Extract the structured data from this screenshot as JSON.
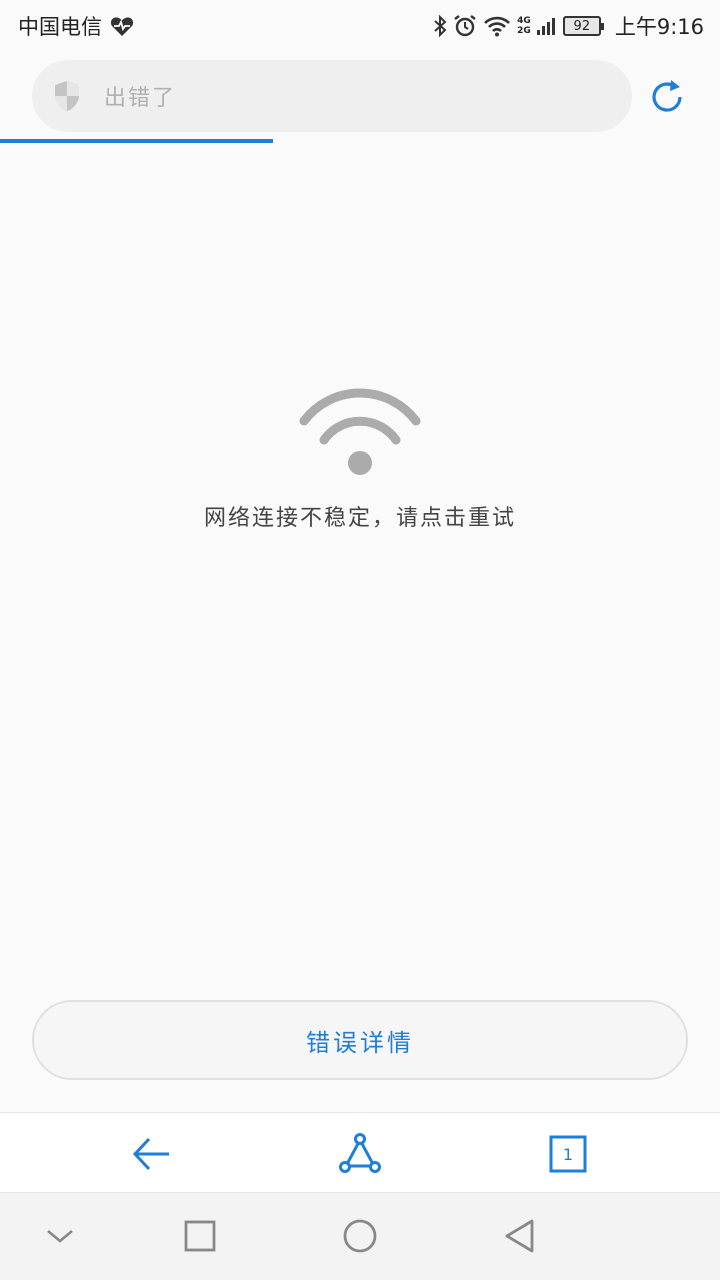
{
  "status_bar": {
    "carrier": "中国电信",
    "net_top": "4G",
    "net_bottom": "2G",
    "battery": "92",
    "time": "上午9:16"
  },
  "address_bar": {
    "title": "出错了"
  },
  "error": {
    "message": "网络连接不稳定，请点击重试"
  },
  "details_button": {
    "label": "错误详情"
  },
  "toolbar": {
    "tabs_count": "1"
  },
  "colors": {
    "accent": "#1e7ed8",
    "icon_gray": "#ababab"
  }
}
